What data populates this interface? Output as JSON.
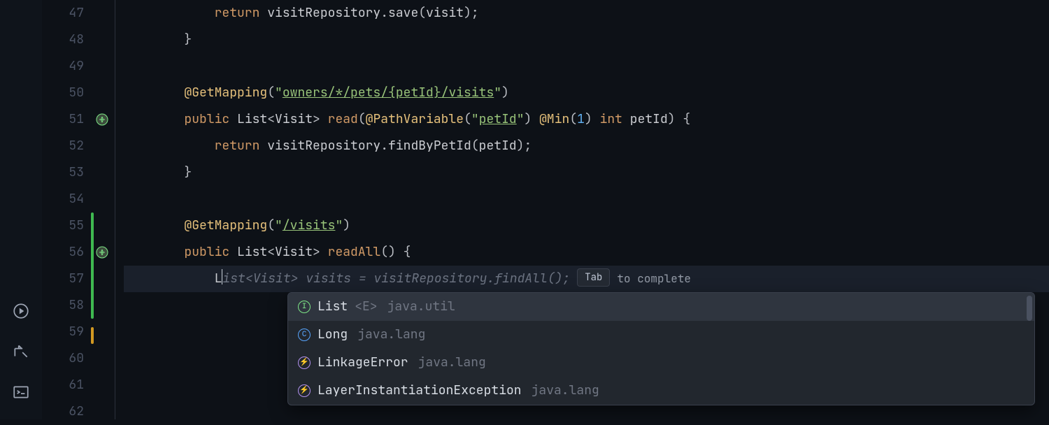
{
  "gutter": {
    "start": 47,
    "count": 16
  },
  "code": {
    "l47": {
      "ret": "return",
      "obj": "visitRepository",
      "call": "save",
      "arg": "visit"
    },
    "l50": {
      "ann": "@GetMapping",
      "path": "owners/*/pets/{petId}/visits"
    },
    "l51": {
      "pub": "public",
      "type": "List",
      "gen": "Visit",
      "fn": "read",
      "pv": "@PathVariable",
      "pvArg": "petId",
      "min": "@Min",
      "minN": "1",
      "argT": "int",
      "argN": "petId"
    },
    "l52": {
      "ret": "return",
      "obj": "visitRepository",
      "call": "findByPetId",
      "arg": "petId"
    },
    "l55": {
      "ann": "@GetMapping",
      "path": "/visits"
    },
    "l56": {
      "pub": "public",
      "type": "List",
      "gen": "Visit",
      "fn": "readAll"
    },
    "l57": {
      "typed": "L",
      "sugg": "ist<Visit> visits = visitRepository.findAll();",
      "tabLabel": "Tab",
      "hint": "to complete"
    }
  },
  "popup": {
    "items": [
      {
        "icon": "I",
        "cls": "green",
        "name": "List",
        "generic": "<E>",
        "pkg": "java.util",
        "selected": true
      },
      {
        "icon": "C",
        "cls": "blue",
        "name": "Long",
        "generic": "",
        "pkg": "java.lang",
        "selected": false
      },
      {
        "icon": "⚡",
        "cls": "purp",
        "name": "LinkageError",
        "generic": "",
        "pkg": "java.lang",
        "selected": false
      },
      {
        "icon": "⚡",
        "cls": "purp",
        "name": "LayerInstantiationException",
        "generic": "",
        "pkg": "java.lang",
        "selected": false
      }
    ]
  },
  "rail": {
    "icons": [
      "run-icon",
      "build-icon",
      "terminal-icon"
    ]
  }
}
